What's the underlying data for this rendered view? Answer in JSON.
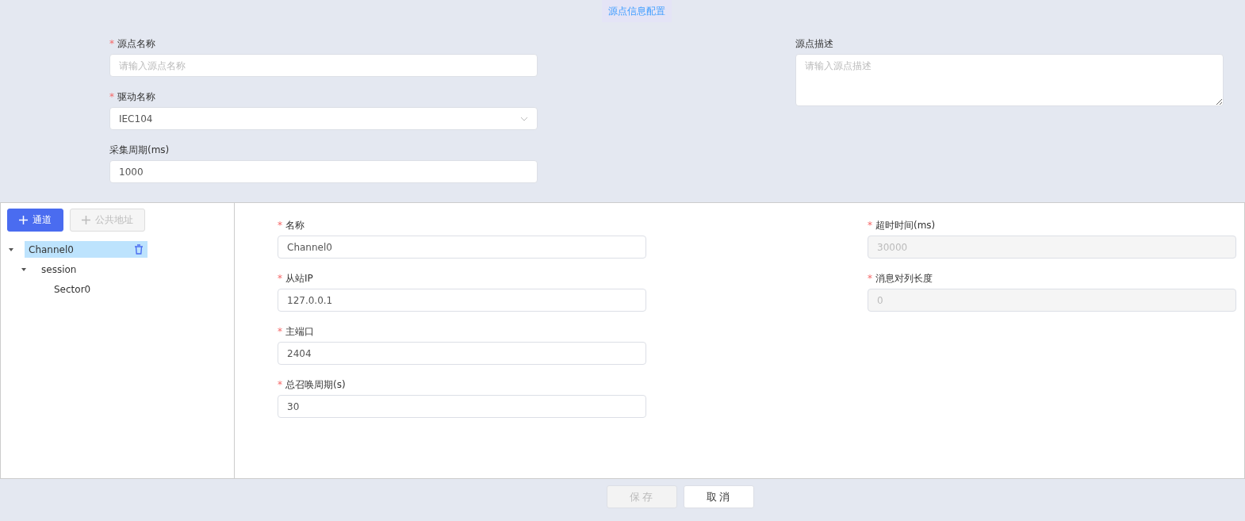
{
  "header": {
    "title": "源点信息配置"
  },
  "source_form": {
    "columns": [
      [
        {
          "kind": "text",
          "label": "源点名称",
          "mark": "*",
          "placeholder": "请输入源点名称"
        },
        {
          "kind": "select",
          "label": "驱动名称",
          "mark": "*",
          "value": "IEC104"
        },
        {
          "kind": "text",
          "label": "采集周期(ms)",
          "value": "1000"
        }
      ],
      [
        {
          "kind": "textarea",
          "label": "源点描述",
          "placeholder": "请输入源点描述"
        }
      ]
    ]
  },
  "toolbar": [
    {
      "label": "通道",
      "disabled": false
    },
    {
      "label": "公共地址",
      "disabled": true
    }
  ],
  "tree": [
    {
      "label": "Channel0",
      "selected": true,
      "expanded": true,
      "children": [
        {
          "label": "session",
          "selected": false,
          "expanded": true,
          "children": [
            {
              "label": "Sector0",
              "selected": false
            }
          ]
        }
      ]
    }
  ],
  "channel_form": {
    "columns": [
      [
        {
          "kind": "text",
          "label": "名称",
          "mark": "*",
          "value": "Channel0"
        },
        {
          "kind": "text",
          "label": "从站IP",
          "mark": "*",
          "value": "127.0.0.1"
        },
        {
          "kind": "text",
          "label": "主端口",
          "mark": "*",
          "value": "2404"
        },
        {
          "kind": "text",
          "label": "总召唤周期(s)",
          "mark": "*",
          "value": "30"
        }
      ],
      [
        {
          "kind": "text",
          "label": "超时时间(ms)",
          "mark": "*",
          "value": "30000",
          "disabled": true
        },
        {
          "kind": "text",
          "label": "消息对列长度",
          "mark": "*",
          "value": "0",
          "disabled": true
        }
      ]
    ]
  },
  "footer": [
    {
      "label": "保存",
      "disabled": true
    },
    {
      "label": "取消",
      "disabled": false
    }
  ]
}
